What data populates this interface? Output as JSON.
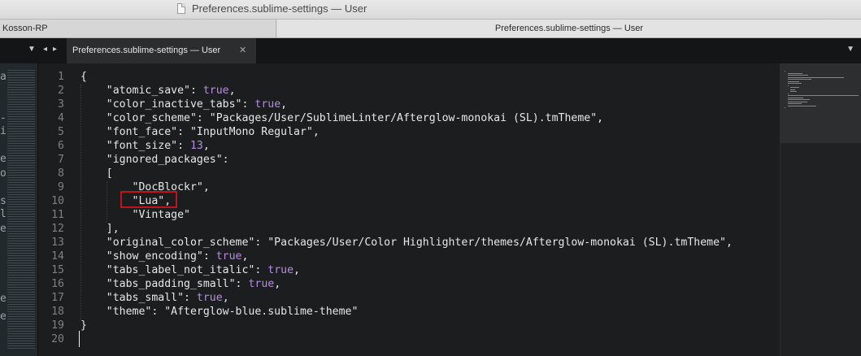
{
  "window": {
    "title": "Preferences.sublime-settings — User"
  },
  "project_tabs": [
    {
      "label": "Kosson-RP"
    },
    {
      "label": "Preferences.sublime-settings — User"
    }
  ],
  "editor_tabs": [
    {
      "label": "Preferences.sublime-settings — User",
      "close_glyph": "✕"
    }
  ],
  "controls": {
    "tabs_menu_glyph": "▼",
    "nav_back_glyph": "◂",
    "nav_forward_glyph": "▸",
    "overflow_menu_glyph": "▼"
  },
  "sidebar": {
    "peek_chars": [
      "a",
      "-",
      "i",
      "e",
      "o",
      "s",
      "l",
      "e",
      "e",
      "e"
    ]
  },
  "editor": {
    "line_numbers": [
      "1",
      "2",
      "3",
      "4",
      "5",
      "6",
      "7",
      "8",
      "9",
      "10",
      "11",
      "12",
      "13",
      "14",
      "15",
      "16",
      "17",
      "18",
      "19",
      "20"
    ],
    "lines": [
      {
        "text": "{",
        "literal": "",
        "tail": ""
      },
      {
        "text": "    \"atomic_save\": ",
        "literal": "true",
        "tail": ","
      },
      {
        "text": "    \"color_inactive_tabs\": ",
        "literal": "true",
        "tail": ","
      },
      {
        "text": "    \"color_scheme\": \"Packages/User/SublimeLinter/Afterglow-monokai (SL).tmTheme\",",
        "literal": "",
        "tail": ""
      },
      {
        "text": "    \"font_face\": \"InputMono Regular\",",
        "literal": "",
        "tail": ""
      },
      {
        "text": "    \"font_size\": ",
        "literal": "13",
        "tail": ","
      },
      {
        "text": "    \"ignored_packages\":",
        "literal": "",
        "tail": ""
      },
      {
        "text": "    [",
        "literal": "",
        "tail": ""
      },
      {
        "text": "        \"DocBlockr\",",
        "literal": "",
        "tail": ""
      },
      {
        "text": "        \"Lua\",",
        "literal": "",
        "tail": ""
      },
      {
        "text": "        \"Vintage\"",
        "literal": "",
        "tail": ""
      },
      {
        "text": "    ],",
        "literal": "",
        "tail": ""
      },
      {
        "text": "    \"original_color_scheme\": \"Packages/User/Color Highlighter/themes/Afterglow-monokai (SL).tmTheme\",",
        "literal": "",
        "tail": ""
      },
      {
        "text": "    \"show_encoding\": ",
        "literal": "true",
        "tail": ","
      },
      {
        "text": "    \"tabs_label_not_italic\": ",
        "literal": "true",
        "tail": ","
      },
      {
        "text": "    \"tabs_padding_small\": ",
        "literal": "true",
        "tail": ","
      },
      {
        "text": "    \"tabs_small\": ",
        "literal": "true",
        "tail": ","
      },
      {
        "text": "    \"theme\": \"Afterglow-blue.sublime-theme\"",
        "literal": "",
        "tail": ""
      },
      {
        "text": "}",
        "literal": "",
        "tail": ""
      },
      {
        "text": "",
        "literal": "",
        "tail": ""
      }
    ],
    "highlighted_line_number": "10"
  },
  "colors": {
    "literal": "#b78be3",
    "highlight_box": "#c0141d",
    "editor_bg": "#1b1d1e"
  }
}
